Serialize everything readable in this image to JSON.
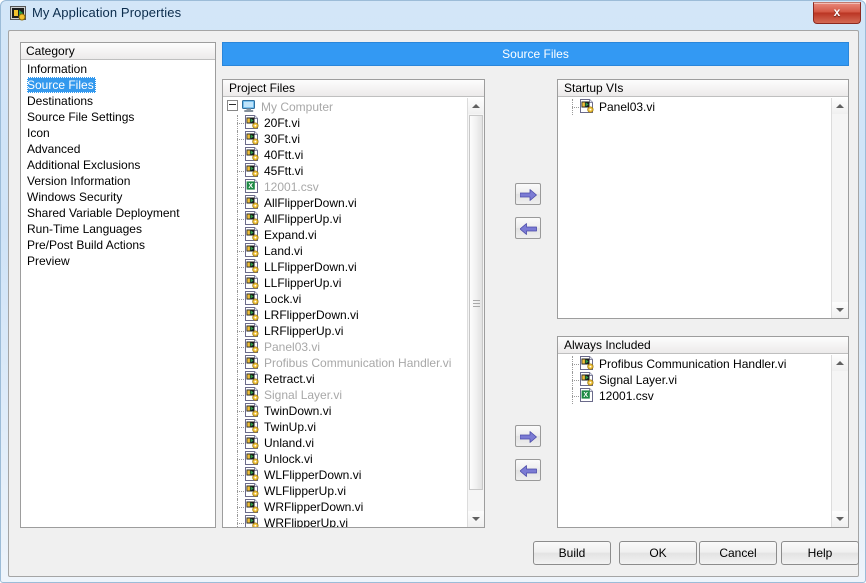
{
  "window": {
    "title": "My Application Properties",
    "icon": "labview-vi-icon",
    "close_label": "x"
  },
  "colors": {
    "header_bar": "#3399f3",
    "selection": "#3399ee",
    "dialog_bg": "#f0f0f0",
    "dim_text": "#a8a8a8"
  },
  "category": {
    "header": "Category",
    "selected": "Source Files",
    "items": [
      "Information",
      "Source Files",
      "Destinations",
      "Source File Settings",
      "Icon",
      "Advanced",
      "Additional Exclusions",
      "Version Information",
      "Windows Security",
      "Shared Variable Deployment",
      "Run-Time Languages",
      "Pre/Post Build Actions",
      "Preview"
    ]
  },
  "page_header": {
    "title": "Source Files"
  },
  "project_files": {
    "header": "Project Files",
    "root": {
      "label": "My Computer",
      "icon": "computer-icon",
      "dim": true,
      "expanded": true
    },
    "items": [
      {
        "label": "20Ft.vi",
        "icon": "vi-icon",
        "dim": false
      },
      {
        "label": "30Ft.vi",
        "icon": "vi-icon",
        "dim": false
      },
      {
        "label": "40Ftt.vi",
        "icon": "vi-icon",
        "dim": false
      },
      {
        "label": "45Ftt.vi",
        "icon": "vi-icon",
        "dim": false
      },
      {
        "label": "12001.csv",
        "icon": "csv-icon",
        "dim": true
      },
      {
        "label": "AllFlipperDown.vi",
        "icon": "vi-icon",
        "dim": false
      },
      {
        "label": "AllFlipperUp.vi",
        "icon": "vi-icon",
        "dim": false
      },
      {
        "label": "Expand.vi",
        "icon": "vi-icon",
        "dim": false
      },
      {
        "label": "Land.vi",
        "icon": "vi-icon",
        "dim": false
      },
      {
        "label": "LLFlipperDown.vi",
        "icon": "vi-icon",
        "dim": false
      },
      {
        "label": "LLFlipperUp.vi",
        "icon": "vi-icon",
        "dim": false
      },
      {
        "label": "Lock.vi",
        "icon": "vi-icon",
        "dim": false
      },
      {
        "label": "LRFlipperDown.vi",
        "icon": "vi-icon",
        "dim": false
      },
      {
        "label": "LRFlipperUp.vi",
        "icon": "vi-icon",
        "dim": false
      },
      {
        "label": "Panel03.vi",
        "icon": "vi-icon",
        "dim": true
      },
      {
        "label": "Profibus Communication Handler.vi",
        "icon": "vi-icon",
        "dim": true
      },
      {
        "label": "Retract.vi",
        "icon": "vi-icon",
        "dim": false
      },
      {
        "label": "Signal Layer.vi",
        "icon": "vi-icon",
        "dim": true
      },
      {
        "label": "TwinDown.vi",
        "icon": "vi-icon",
        "dim": false
      },
      {
        "label": "TwinUp.vi",
        "icon": "vi-icon",
        "dim": false
      },
      {
        "label": "Unland.vi",
        "icon": "vi-icon",
        "dim": false
      },
      {
        "label": "Unlock.vi",
        "icon": "vi-icon",
        "dim": false
      },
      {
        "label": "WLFlipperDown.vi",
        "icon": "vi-icon",
        "dim": false
      },
      {
        "label": "WLFlipperUp.vi",
        "icon": "vi-icon",
        "dim": false
      },
      {
        "label": "WRFlipperDown.vi",
        "icon": "vi-icon",
        "dim": false
      },
      {
        "label": "WRFlipperUp.vi",
        "icon": "vi-icon",
        "dim": false
      }
    ]
  },
  "startup_vis": {
    "header": "Startup VIs",
    "items": [
      {
        "label": "Panel03.vi",
        "icon": "vi-icon",
        "dim": false
      }
    ]
  },
  "always_included": {
    "header": "Always Included",
    "items": [
      {
        "label": "Profibus Communication Handler.vi",
        "icon": "vi-icon",
        "dim": false
      },
      {
        "label": "Signal Layer.vi",
        "icon": "vi-icon",
        "dim": false
      },
      {
        "label": "12001.csv",
        "icon": "csv-icon",
        "dim": false
      }
    ]
  },
  "transfer_buttons": {
    "startup_add": "arrow-right-icon",
    "startup_remove": "arrow-left-icon",
    "included_add": "arrow-right-icon",
    "included_remove": "arrow-left-icon"
  },
  "footer": {
    "build": "Build",
    "ok": "OK",
    "cancel": "Cancel",
    "help": "Help"
  }
}
